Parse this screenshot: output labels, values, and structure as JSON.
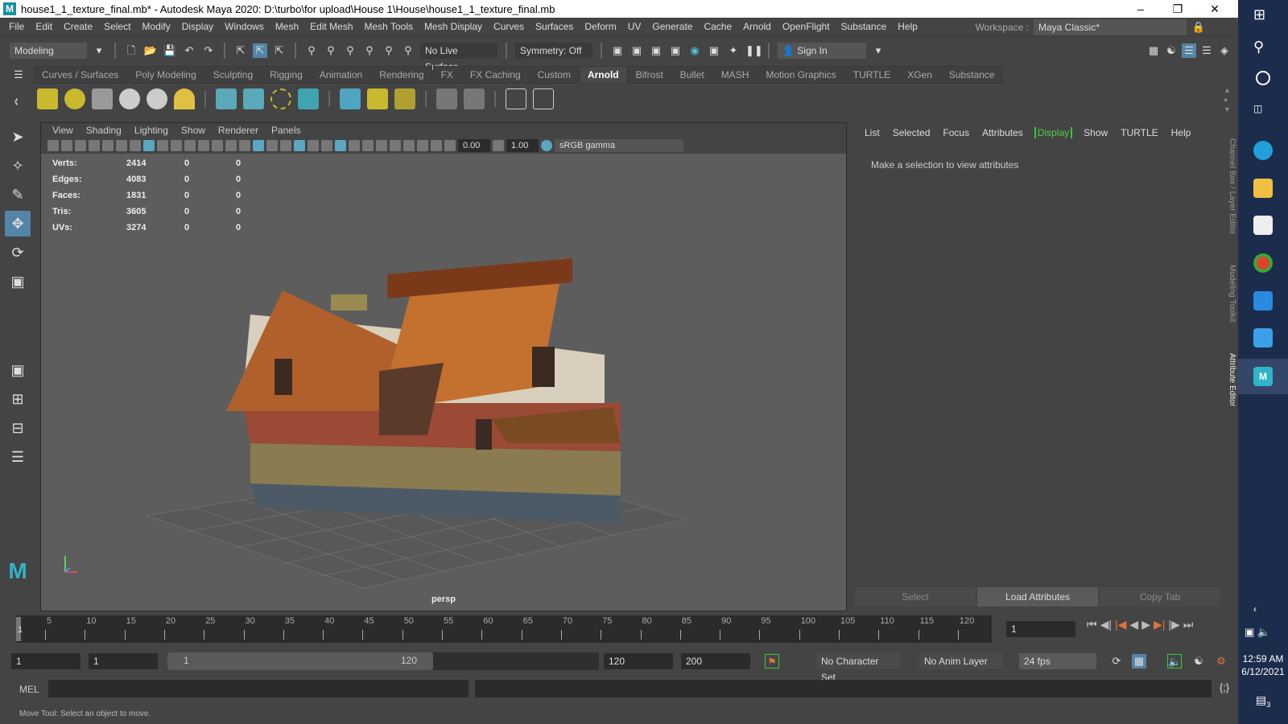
{
  "title_bar": {
    "title": "house1_1_texture_final.mb* - Autodesk Maya 2020: D:\\turbo\\for upload\\House 1\\House\\house1_1_texture_final.mb",
    "app_icon": "M"
  },
  "menu": [
    "File",
    "Edit",
    "Create",
    "Select",
    "Modify",
    "Display",
    "Windows",
    "Mesh",
    "Edit Mesh",
    "Mesh Tools",
    "Mesh Display",
    "Curves",
    "Surfaces",
    "Deform",
    "UV",
    "Generate",
    "Cache",
    "Arnold",
    "OpenFlight",
    "Substance",
    "Help"
  ],
  "workspace": {
    "label": "Workspace :",
    "value": "Maya Classic*"
  },
  "status_line": {
    "mode": "Modeling",
    "live_surface": "No Live Surface",
    "symmetry": "Symmetry: Off",
    "sign_in": "Sign In"
  },
  "shelf_tabs": [
    "Curves / Surfaces",
    "Poly Modeling",
    "Sculpting",
    "Rigging",
    "Animation",
    "Rendering",
    "FX",
    "FX Caching",
    "Custom",
    "Arnold",
    "Bifrost",
    "Bullet",
    "MASH",
    "Motion Graphics",
    "TURTLE",
    "XGen",
    "Substance"
  ],
  "shelf_active": "Arnold",
  "viewport": {
    "menu": [
      "View",
      "Shading",
      "Lighting",
      "Show",
      "Renderer",
      "Panels"
    ],
    "exposure": "0.00",
    "gamma": "1.00",
    "color_space": "sRGB gamma",
    "hud": [
      [
        "Verts:",
        "2414",
        "0",
        "0"
      ],
      [
        "Edges:",
        "4083",
        "0",
        "0"
      ],
      [
        "Faces:",
        "1831",
        "0",
        "0"
      ],
      [
        "Tris:",
        "3605",
        "0",
        "0"
      ],
      [
        "UVs:",
        "3274",
        "0",
        "0"
      ]
    ],
    "camera": "persp"
  },
  "attribute_editor": {
    "menu": [
      "List",
      "Selected",
      "Focus",
      "Attributes",
      "Display",
      "Show",
      "TURTLE",
      "Help"
    ],
    "message": "Make a selection to view attributes",
    "buttons": [
      "Select",
      "Load Attributes",
      "Copy Tab"
    ]
  },
  "side_tabs": [
    "Channel Box / Layer Editor",
    "Modeling Toolkit",
    "Attribute Editor"
  ],
  "timeline": {
    "ticks": [
      "5",
      "10",
      "15",
      "20",
      "25",
      "30",
      "35",
      "40",
      "45",
      "50",
      "55",
      "60",
      "65",
      "70",
      "75",
      "80",
      "85",
      "90",
      "95",
      "100",
      "105",
      "110",
      "115",
      "120"
    ],
    "current_frame": "1",
    "current_marker": "1"
  },
  "range": {
    "start": "1",
    "playback_start": "1",
    "slider_start": "1",
    "slider_end": "120",
    "playback_end": "120",
    "end": "200",
    "character_set": "No Character Set",
    "anim_layer": "No Anim Layer",
    "fps": "24 fps"
  },
  "command_line": {
    "language": "MEL"
  },
  "help_line": "Move Tool: Select an object to move.",
  "taskbar": {
    "time": "12:59 AM",
    "date": "6/12/2021",
    "notifications": "3"
  }
}
